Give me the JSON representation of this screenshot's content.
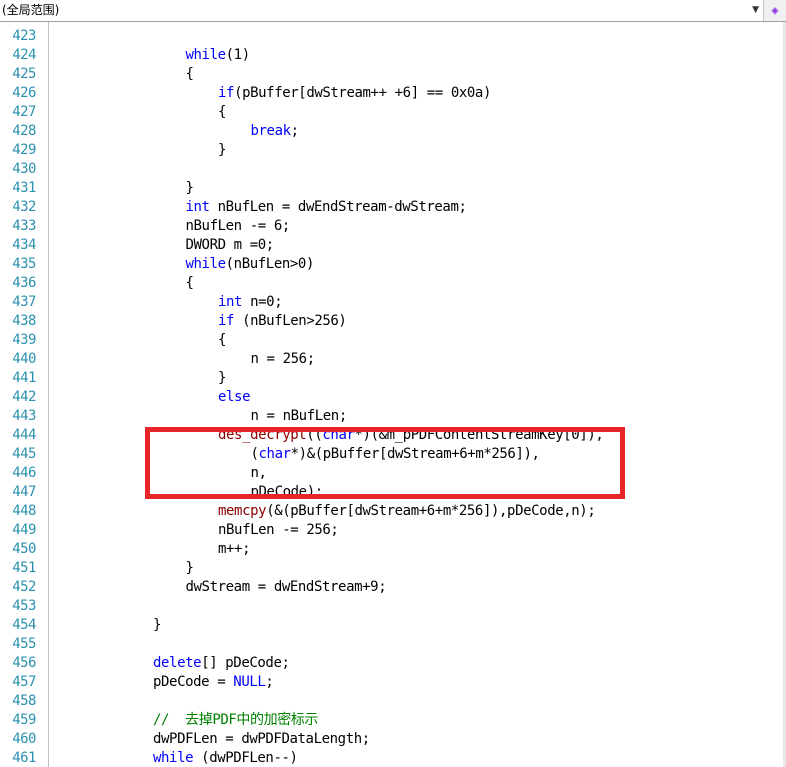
{
  "toolbar": {
    "scope_label": "(全局范围)",
    "dropdown_icon": "chevron-down-icon",
    "nav_icon": "member-navigation-icon"
  },
  "editor": {
    "colors": {
      "line_number": "#2b91af",
      "keyword": "#0000ff",
      "function": "#8b0000",
      "comment": "#008000",
      "highlight_box": "#e8262a"
    },
    "lines": [
      {
        "n": "423",
        "indent": 0,
        "parts": [
          {
            "t": "",
            "c": ""
          }
        ]
      },
      {
        "n": "424",
        "indent": 4,
        "parts": [
          {
            "t": "while",
            "c": "kw"
          },
          {
            "t": "(1)",
            "c": ""
          }
        ]
      },
      {
        "n": "425",
        "indent": 4,
        "parts": [
          {
            "t": "{",
            "c": ""
          }
        ]
      },
      {
        "n": "426",
        "indent": 5,
        "parts": [
          {
            "t": "if",
            "c": "kw"
          },
          {
            "t": "(pBuffer[dwStream++ +6] == 0x0a)",
            "c": ""
          }
        ]
      },
      {
        "n": "427",
        "indent": 5,
        "parts": [
          {
            "t": "{",
            "c": ""
          }
        ]
      },
      {
        "n": "428",
        "indent": 6,
        "parts": [
          {
            "t": "break",
            "c": "kw"
          },
          {
            "t": ";",
            "c": ""
          }
        ]
      },
      {
        "n": "429",
        "indent": 5,
        "parts": [
          {
            "t": "}",
            "c": ""
          }
        ]
      },
      {
        "n": "430",
        "indent": 0,
        "parts": [
          {
            "t": "",
            "c": ""
          }
        ]
      },
      {
        "n": "431",
        "indent": 4,
        "parts": [
          {
            "t": "}",
            "c": ""
          }
        ]
      },
      {
        "n": "432",
        "indent": 4,
        "parts": [
          {
            "t": "int",
            "c": "kw"
          },
          {
            "t": " nBufLen = dwEndStream-dwStream;",
            "c": ""
          }
        ]
      },
      {
        "n": "433",
        "indent": 4,
        "parts": [
          {
            "t": "nBufLen -= 6;",
            "c": ""
          }
        ]
      },
      {
        "n": "434",
        "indent": 4,
        "parts": [
          {
            "t": "DWORD m =0;",
            "c": ""
          }
        ]
      },
      {
        "n": "435",
        "indent": 4,
        "parts": [
          {
            "t": "while",
            "c": "kw"
          },
          {
            "t": "(nBufLen>0)",
            "c": ""
          }
        ]
      },
      {
        "n": "436",
        "indent": 4,
        "parts": [
          {
            "t": "{",
            "c": ""
          }
        ]
      },
      {
        "n": "437",
        "indent": 5,
        "parts": [
          {
            "t": "int",
            "c": "kw"
          },
          {
            "t": " n=0;",
            "c": ""
          }
        ]
      },
      {
        "n": "438",
        "indent": 5,
        "parts": [
          {
            "t": "if",
            "c": "kw"
          },
          {
            "t": " (nBufLen>256)",
            "c": ""
          }
        ]
      },
      {
        "n": "439",
        "indent": 5,
        "parts": [
          {
            "t": "{",
            "c": ""
          }
        ]
      },
      {
        "n": "440",
        "indent": 6,
        "parts": [
          {
            "t": "n = 256;",
            "c": ""
          }
        ]
      },
      {
        "n": "441",
        "indent": 5,
        "parts": [
          {
            "t": "}",
            "c": ""
          }
        ]
      },
      {
        "n": "442",
        "indent": 5,
        "parts": [
          {
            "t": "else",
            "c": "kw"
          }
        ]
      },
      {
        "n": "443",
        "indent": 6,
        "parts": [
          {
            "t": "n = nBufLen;",
            "c": ""
          }
        ]
      },
      {
        "n": "444",
        "indent": 5,
        "parts": [
          {
            "t": "des_decrypt",
            "c": "fn"
          },
          {
            "t": "((",
            "c": ""
          },
          {
            "t": "char",
            "c": "kw"
          },
          {
            "t": "*)(&m_pPDFContentStreamKey[0]),",
            "c": ""
          }
        ]
      },
      {
        "n": "445",
        "indent": 6,
        "parts": [
          {
            "t": "(",
            "c": ""
          },
          {
            "t": "char",
            "c": "kw"
          },
          {
            "t": "*)&(pBuffer[dwStream+6+m*256]),",
            "c": ""
          }
        ]
      },
      {
        "n": "446",
        "indent": 6,
        "parts": [
          {
            "t": "n,",
            "c": ""
          }
        ]
      },
      {
        "n": "447",
        "indent": 6,
        "parts": [
          {
            "t": "pDeCode);",
            "c": ""
          }
        ]
      },
      {
        "n": "448",
        "indent": 5,
        "parts": [
          {
            "t": "memcpy",
            "c": "fn"
          },
          {
            "t": "(&(pBuffer[dwStream+6+m*256]),pDeCode,n);",
            "c": ""
          }
        ]
      },
      {
        "n": "449",
        "indent": 5,
        "parts": [
          {
            "t": "nBufLen -= 256;",
            "c": ""
          }
        ]
      },
      {
        "n": "450",
        "indent": 5,
        "parts": [
          {
            "t": "m++;",
            "c": ""
          }
        ]
      },
      {
        "n": "451",
        "indent": 4,
        "parts": [
          {
            "t": "}",
            "c": ""
          }
        ]
      },
      {
        "n": "452",
        "indent": 4,
        "parts": [
          {
            "t": "dwStream = dwEndStream+9;",
            "c": ""
          }
        ]
      },
      {
        "n": "453",
        "indent": 0,
        "parts": [
          {
            "t": "",
            "c": ""
          }
        ]
      },
      {
        "n": "454",
        "indent": 3,
        "parts": [
          {
            "t": "}",
            "c": ""
          }
        ]
      },
      {
        "n": "455",
        "indent": 0,
        "parts": [
          {
            "t": "",
            "c": ""
          }
        ]
      },
      {
        "n": "456",
        "indent": 3,
        "parts": [
          {
            "t": "delete",
            "c": "kw"
          },
          {
            "t": "[] pDeCode;",
            "c": ""
          }
        ]
      },
      {
        "n": "457",
        "indent": 3,
        "parts": [
          {
            "t": "pDeCode = ",
            "c": ""
          },
          {
            "t": "NULL",
            "c": "kw"
          },
          {
            "t": ";",
            "c": ""
          }
        ]
      },
      {
        "n": "458",
        "indent": 0,
        "parts": [
          {
            "t": "",
            "c": ""
          }
        ]
      },
      {
        "n": "459",
        "indent": 3,
        "parts": [
          {
            "t": "//  去掉PDF中的加密标示",
            "c": "cm"
          }
        ]
      },
      {
        "n": "460",
        "indent": 3,
        "parts": [
          {
            "t": "dwPDFLen = dwPDFDataLength;",
            "c": ""
          }
        ]
      },
      {
        "n": "461",
        "indent": 3,
        "parts": [
          {
            "t": "while",
            "c": "kw"
          },
          {
            "t": " (dwPDFLen--)",
            "c": ""
          }
        ]
      }
    ]
  }
}
